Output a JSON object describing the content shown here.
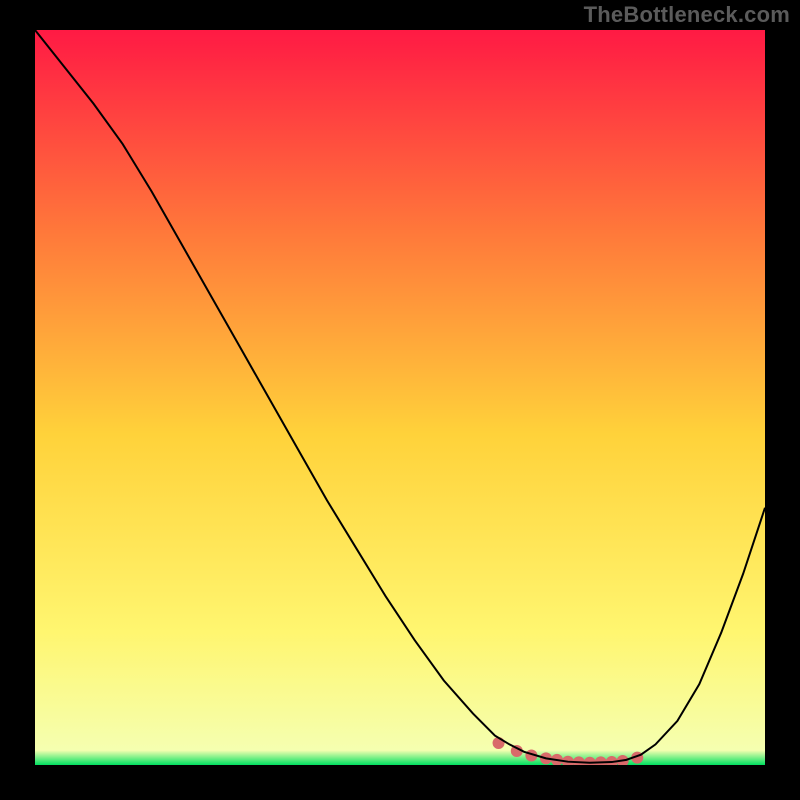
{
  "watermark": "TheBottleneck.com",
  "chart_data": {
    "type": "line",
    "title": "",
    "xlabel": "",
    "ylabel": "",
    "xlim": [
      0,
      100
    ],
    "ylim": [
      0,
      100
    ],
    "grid": false,
    "legend": false,
    "gradient_colors": {
      "top": "#ff1a44",
      "mid_upper": "#ff7a3a",
      "mid": "#ffd23a",
      "mid_lower": "#fff670",
      "bottom": "#00e060"
    },
    "series": [
      {
        "name": "curve",
        "color": "#000000",
        "stroke_width": 2,
        "x": [
          0,
          4,
          8,
          12,
          16,
          20,
          24,
          28,
          32,
          36,
          40,
          44,
          48,
          52,
          56,
          60,
          63,
          65,
          67,
          70,
          73,
          76,
          79,
          81,
          83,
          85,
          88,
          91,
          94,
          97,
          100
        ],
        "y": [
          100,
          95,
          90,
          84.5,
          78,
          71,
          64,
          57,
          50,
          43,
          36,
          29.5,
          23,
          17,
          11.5,
          7,
          4,
          2.8,
          1.8,
          0.9,
          0.45,
          0.3,
          0.4,
          0.7,
          1.4,
          2.8,
          6,
          11,
          18,
          26,
          35
        ]
      },
      {
        "name": "valley-highlight",
        "color": "#d96a6a",
        "type": "scatter",
        "marker_radius": 6,
        "x": [
          63.5,
          66,
          68,
          70,
          71.5,
          73,
          74.5,
          76,
          77.5,
          79,
          80.5,
          82.5
        ],
        "y": [
          3.0,
          1.9,
          1.3,
          0.9,
          0.7,
          0.45,
          0.35,
          0.3,
          0.35,
          0.4,
          0.55,
          1.0
        ]
      }
    ]
  }
}
